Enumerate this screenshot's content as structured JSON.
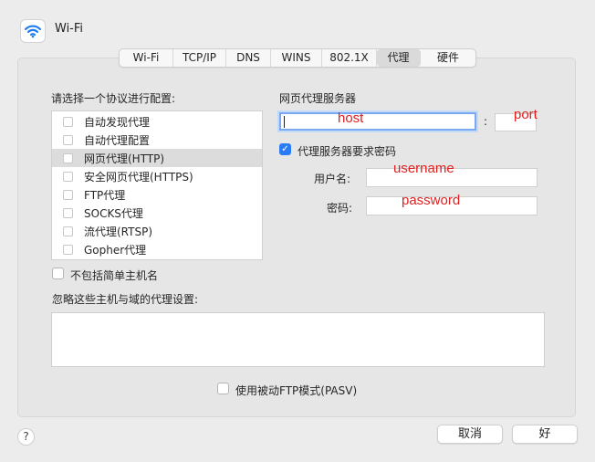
{
  "header": {
    "title": "Wi-Fi"
  },
  "tabs": [
    {
      "label": "Wi-Fi",
      "active": false
    },
    {
      "label": "TCP/IP",
      "active": false
    },
    {
      "label": "DNS",
      "active": false
    },
    {
      "label": "WINS",
      "active": false
    },
    {
      "label": "802.1X",
      "active": false
    },
    {
      "label": "代理",
      "active": true
    },
    {
      "label": "硬件",
      "active": false
    }
  ],
  "protocols": {
    "label": "请选择一个协议进行配置:",
    "items": [
      {
        "label": "自动发现代理",
        "checked": false,
        "selected": false
      },
      {
        "label": "自动代理配置",
        "checked": false,
        "selected": false
      },
      {
        "label": "网页代理(HTTP)",
        "checked": false,
        "selected": true
      },
      {
        "label": "安全网页代理(HTTPS)",
        "checked": false,
        "selected": false
      },
      {
        "label": "FTP代理",
        "checked": false,
        "selected": false
      },
      {
        "label": "SOCKS代理",
        "checked": false,
        "selected": false
      },
      {
        "label": "流代理(RTSP)",
        "checked": false,
        "selected": false
      },
      {
        "label": "Gopher代理",
        "checked": false,
        "selected": false
      }
    ]
  },
  "proxy_server": {
    "label": "网页代理服务器",
    "host_annotation": "host",
    "colon": ":",
    "port_annotation": "port",
    "requires_password_label": "代理服务器要求密码",
    "requires_password_checked": true,
    "username_label": "用户名:",
    "username_annotation": "username",
    "password_label": "密码:",
    "password_annotation": "password"
  },
  "exclude_simple": {
    "label": "不包括简单主机名",
    "checked": false
  },
  "bypass": {
    "label": "忽略这些主机与域的代理设置:",
    "value": ""
  },
  "pasv": {
    "label": "使用被动FTP模式(PASV)",
    "checked": false
  },
  "buttons": {
    "help": "?",
    "cancel": "取消",
    "ok": "好"
  },
  "colors": {
    "accent": "#2a7cf6",
    "annotation": "#e02020",
    "wifi": "#1f7cf2"
  }
}
